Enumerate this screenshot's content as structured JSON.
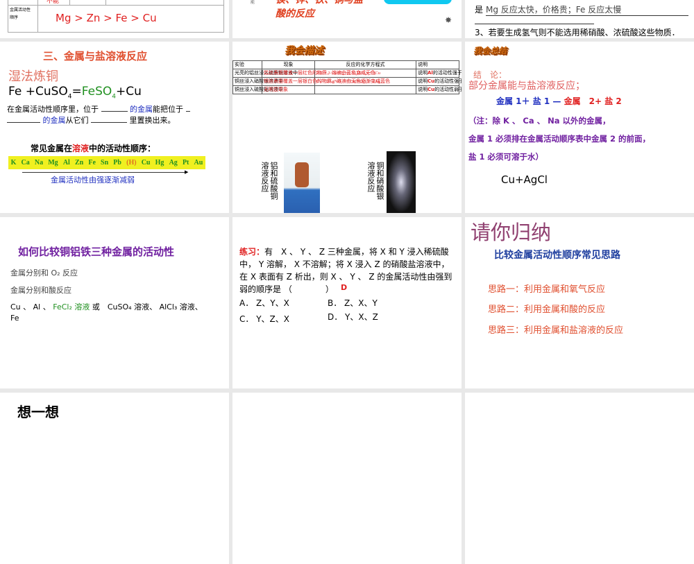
{
  "slides": [
    {
      "id": "s1",
      "cell_text": "不能",
      "row_label": "金属活动性顺序",
      "order": "Mg > Zn > Fe > Cu"
    },
    {
      "id": "s2",
      "caption": "镁、锌、铁、铜与盐酸的反应",
      "small": "能"
    },
    {
      "id": "s3",
      "line2_prefix": "是",
      "line2": "Mg 反应太快，价格贵；Fe 反应太慢",
      "line3": "3、若要生成氢气则不能选用稀硝酸、浓硫酸这些物质．"
    },
    {
      "id": "s4",
      "title": "三、金属与盐溶液反应",
      "subtitle": "湿法炼铜",
      "eq_a": "Fe +CuSO",
      "eq_sub": "4",
      "eq_eq": "=",
      "eq_b": "FeSO",
      "eq_c": "+Cu",
      "line1_a": "在金属活动性顺序里，位于",
      "line1_b": "的金属",
      "line1_c": "能把位于",
      "line2_b": "的金属",
      "line2_c": "从它们",
      "line2_d": "里置换出来。",
      "order_title_a": "常见金属在",
      "order_title_b": "溶液",
      "order_title_c": "中的活动性顺序：",
      "metals": [
        "K",
        "Ca",
        "Na",
        "Mg",
        "Al",
        "Zn",
        "Fe",
        "Sn",
        "Pb",
        "(H)",
        "Cu",
        "Hg",
        "Ag",
        "Pt",
        "Au"
      ],
      "arrow_label": "金属活动性由强逐渐减弱"
    },
    {
      "id": "s5",
      "art": "我会描述",
      "headers": [
        "实验",
        "现象",
        "反应的化学方程式",
        "说明"
      ],
      "rows": [
        {
          "exp": "光亮的铝丝浸入硫酸铜溶液中",
          "obs": "铝丝表面覆盖一层红色的物质，溶液由蓝色变成无色",
          "eq": "2Al + 3 CuSO₄ == Al₂(SO₄)₃+ 3Cu",
          "note_a": "说明",
          "ans1": "Al",
          "note_b": "的活动性强于",
          "ans2": "Cu"
        },
        {
          "exp": "铜丝浸入硝酸银溶液中",
          "obs": "铜丝表面覆盖一层银白色的物质，溶液由无色逐渐变成蓝色",
          "eq": "Cu + 2AgNO₃ == Cu(NO₃)₂ + 2Ag",
          "note_a": "说明",
          "ans1": "Cu",
          "note_b": "的活动性强于",
          "ans2": "Ag"
        },
        {
          "exp": "铜丝浸入硫酸铝溶液中",
          "obs": "无明显现象",
          "eq": "",
          "note_a": "说明",
          "ans1": "Cu",
          "note_b": "的活动性弱于",
          "ans2": "Al"
        }
      ],
      "cap1": "铝和硫酸铜溶液反应",
      "cap2": "铜和硝酸银溶液反应"
    },
    {
      "id": "s6",
      "art": "我会总结",
      "concl": "结　论：",
      "l1": "部分金属能与盐溶液反应；",
      "f1": "金属 1＋ 盐 1",
      "f2": "金属　2+ 盐 2",
      "n1": "（注：除 K 、 Ca 、 Na 以外的金属，",
      "n2": "金属 1 必须排在金属活动顺序表中金属 2 的前面，",
      "n3": "盐 1 必须可溶于水）",
      "ex": "Cu+AgCl"
    },
    {
      "id": "s7",
      "title": "如何比较铜铝铁三种金属的活动性",
      "l1": "金属分别和 O₂ 反应",
      "l2": "金属分别和酸反应",
      "l3a": "Cu 、 Al 、",
      "l3b": "FeCl₂ 溶液",
      "l3c": "或　CuSO₄ 溶液、 AlCl₃ 溶液、",
      "l4": "Fe"
    },
    {
      "id": "s8",
      "label": "练习：",
      "q": "有　X 、 Y 、 Z 三种金属，将 X 和 Y 浸入稀硫酸中， Y 溶解， X 不溶解；将 X 浸入 Z 的硝酸盐溶液中，在 X 表面有 Z 析出，则 X 、 Y 、 Z 的金属活动性由强到弱的顺序是 （　　　　）",
      "answer": "D",
      "opts": [
        "A． Z、Y、X",
        "B． Z、X、Y",
        "C． Y、Z、X",
        "D． Y、X、Z"
      ]
    },
    {
      "id": "s9",
      "title": "请你归纳",
      "subtitle": "比较金属活动性顺序常见思路",
      "ideas": [
        "思路一：利用金属和氧气反应",
        "思路二：利用金属和酸的反应",
        "思路三：利用金属和盐溶液的反应"
      ]
    },
    {
      "id": "s10",
      "title": "想一想"
    }
  ],
  "colors": {
    "gap": "#e8e8e8",
    "red": "#e02020",
    "blue": "#2030c0",
    "purple": "#7020a0"
  }
}
